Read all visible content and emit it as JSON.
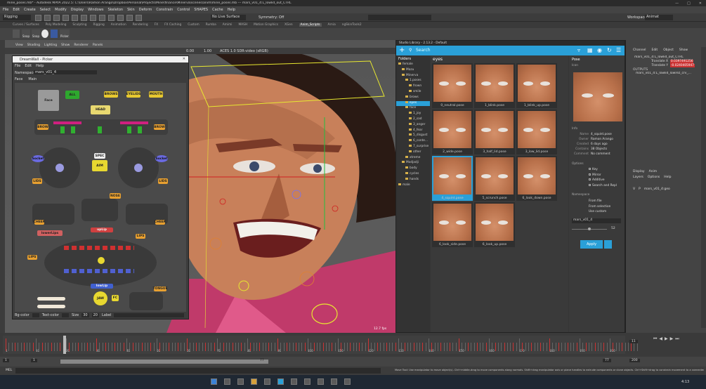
{
  "title": "mine_poses.mb* - Autodesk MAYA 2022.5: C:\\Users\\Ramon Arango\\Dropbox\\Personal\\Projects\\Mine\\finance\\Minerva\\scenes\\anim\\mine_poses.mb --- mars_v01_4:L_lowlid_out_CTRL",
  "menu": [
    "File",
    "Edit",
    "Create",
    "Select",
    "Modify",
    "Display",
    "Windows",
    "Skeleton",
    "Skin",
    "Deform",
    "Constrain",
    "Control",
    "SHAPES",
    "Cache",
    "Help"
  ],
  "statusline": {
    "mode": "Rigging",
    "live_surface": "No Live Surface",
    "symmetry": "Symmetry: Off",
    "workspace_label": "Workspace:",
    "workspace": "Animat"
  },
  "shelf_tabs": [
    "Curves / Surfaces",
    "Poly Modeling",
    "Sculpting",
    "Rigging",
    "Animation",
    "Rendering",
    "FX",
    "FX Caching",
    "Custom",
    "Rumba",
    "Amimi",
    "MASH",
    "Motion Graphics",
    "XGen",
    "Anim_Scripts",
    "Arnia",
    "ngSkinTools2"
  ],
  "shelf_buttons": [
    "Snap",
    "Snap",
    "Picker"
  ],
  "viewport": {
    "menu": [
      "View",
      "Shading",
      "Lighting",
      "Show",
      "Renderer",
      "Panels"
    ],
    "fields": [
      "0.00",
      "1.00"
    ],
    "colorspace": "ACES 1.0 SDR-video (sRGB)",
    "fps": "12.7 fps"
  },
  "picker": {
    "title": "DreamWall - Picker",
    "menu": [
      "File",
      "Edit",
      "Help"
    ],
    "namespace_label": "Namespace",
    "namespace": "mars_v01_4",
    "tabs": [
      "Face",
      "Main"
    ],
    "buttons": {
      "face": "Face",
      "all": "ALL",
      "brows": "BROWS",
      "eyelids": "EYELIDS",
      "mouth": "MOUTH",
      "head": "HEAD",
      "brow_l": "BROW",
      "brow_r": "BROW",
      "socket_l": "Socket",
      "socket_r": "Socket",
      "spec": "SPEC",
      "aim": "AIM",
      "lids_l": "LIDS",
      "lids_r": "LIDS",
      "nose": "NOSE",
      "cheek_l": "CHEEK",
      "cheek_r": "CHEEK",
      "upper_lip": "upLip",
      "lower_lip": "lowLip",
      "lips_l": "LIPS",
      "lips_r": "LIPS",
      "jaw": "JAW",
      "fc": "FC",
      "tongue": "TONGUE",
      "lowerlip_label": "lowerLips"
    },
    "footer": {
      "bg_color": "Bg-color",
      "text_color": "Text-color",
      "size": "Size",
      "w": "30",
      "h": "20",
      "label": "Label"
    }
  },
  "studio": {
    "title": "Studio Library - 2.13.2 - Default",
    "search_placeholder": "Search",
    "folders_header": "Folders",
    "folders": [
      {
        "name": "female",
        "depth": 0,
        "selected": false
      },
      {
        "name": "Mazu",
        "depth": 1,
        "selected": false
      },
      {
        "name": "Minerva",
        "depth": 1,
        "selected": false
      },
      {
        "name": "1.poses",
        "depth": 2,
        "selected": false
      },
      {
        "name": "frown",
        "depth": 3,
        "selected": false
      },
      {
        "name": "smile",
        "depth": 3,
        "selected": false
      },
      {
        "name": "brows",
        "depth": 2,
        "selected": false
      },
      {
        "name": "eyes",
        "depth": 2,
        "selected": true
      },
      {
        "name": "face",
        "depth": 2,
        "selected": false
      },
      {
        "name": "1_joy",
        "depth": 3,
        "selected": false
      },
      {
        "name": "2_sad",
        "depth": 3,
        "selected": false
      },
      {
        "name": "3_anger",
        "depth": 3,
        "selected": false
      },
      {
        "name": "4_fear",
        "depth": 3,
        "selected": false
      },
      {
        "name": "5_disgust",
        "depth": 3,
        "selected": false
      },
      {
        "name": "6_conte...",
        "depth": 3,
        "selected": false
      },
      {
        "name": "7_surprise",
        "depth": 3,
        "selected": false
      },
      {
        "name": "other",
        "depth": 3,
        "selected": false
      },
      {
        "name": "xtreme",
        "depth": 2,
        "selected": false
      },
      {
        "name": "Modjadji",
        "depth": 1,
        "selected": false
      },
      {
        "name": "body",
        "depth": 2,
        "selected": false
      },
      {
        "name": "cycles",
        "depth": 2,
        "selected": false
      },
      {
        "name": "hands",
        "depth": 2,
        "selected": false
      },
      {
        "name": "male",
        "depth": 0,
        "selected": false
      }
    ],
    "grid_header": "eyes",
    "poses": [
      {
        "name": "0_neutral.pose",
        "selected": false
      },
      {
        "name": "1_blink.pose",
        "selected": false
      },
      {
        "name": "1_blink_up.pose",
        "selected": false
      },
      {
        "name": "2_wide.pose",
        "selected": false
      },
      {
        "name": "3_half_lid.pose",
        "selected": false
      },
      {
        "name": "3_low_lid.pose",
        "selected": false
      },
      {
        "name": "4_squint.pose",
        "selected": true
      },
      {
        "name": "5_scrunch.pose",
        "selected": false
      },
      {
        "name": "6_look_down.pose",
        "selected": false
      },
      {
        "name": "6_look_side.pose",
        "selected": false
      },
      {
        "name": "6_look_up.pose",
        "selected": false
      }
    ],
    "pose_panel": {
      "header": "Pose",
      "icon_section": "Icon",
      "info_section": "Info",
      "info": [
        {
          "k": "Name",
          "v": "4_squint.pose"
        },
        {
          "k": "Owner",
          "v": "Ramon Arango"
        },
        {
          "k": "Created",
          "v": "6 days ago"
        },
        {
          "k": "Contains",
          "v": "38 Objects"
        },
        {
          "k": "Comment",
          "v": "No comment"
        }
      ],
      "options_section": "Options",
      "options": [
        "Key",
        "Mirror",
        "Additive",
        "Search and Repl"
      ],
      "namespace_section": "Namespace",
      "namespace_options": [
        "From file",
        "From selection",
        "Use custom"
      ],
      "namespace_value": "mars_v01_4",
      "slider_value": "52",
      "apply": "Apply"
    }
  },
  "channel_box": {
    "tabs": [
      "Channel",
      "Edit",
      "Object",
      "Show"
    ],
    "node": "mars_v01_4:L_lowlid_out_CTRL",
    "attrs": [
      {
        "k": "Translate X",
        "v": "0.0397491256"
      },
      {
        "k": "Translate Y",
        "v": "-0.0240405947"
      }
    ],
    "outputs_label": "OUTPUTS",
    "output": "mars_v01_4:L_lowlid_lowrez_crv_...",
    "layer_tabs": [
      "Display",
      "Anim"
    ],
    "layer_menu": [
      "Layers",
      "Options",
      "Help"
    ],
    "layer": {
      "v": "V",
      "p": "P",
      "name": "mars_v01_4:geo"
    }
  },
  "timeline": {
    "ticks": [
      "1",
      "10",
      "20",
      "30",
      "40",
      "50",
      "60",
      "70",
      "80",
      "90",
      "100",
      "110",
      "120",
      "130",
      "140",
      "150",
      "160",
      "170",
      "180",
      "190",
      "200"
    ],
    "current": "11",
    "start": "1",
    "range_start": "1",
    "range_end": "77",
    "end_a": "77",
    "end_b": "200"
  },
  "cmdline": {
    "label": "MEL",
    "help": "Move Tool: Use manipulator to move object(s). Ctrl+middle-drag to move components along normals. Shift+drag manipulator axis or plane handles to extrude components or clone objects. Ctrl+Shift+drag to constrain movement to a connected edge. Use"
  },
  "taskbar": {
    "time": "4:13"
  }
}
